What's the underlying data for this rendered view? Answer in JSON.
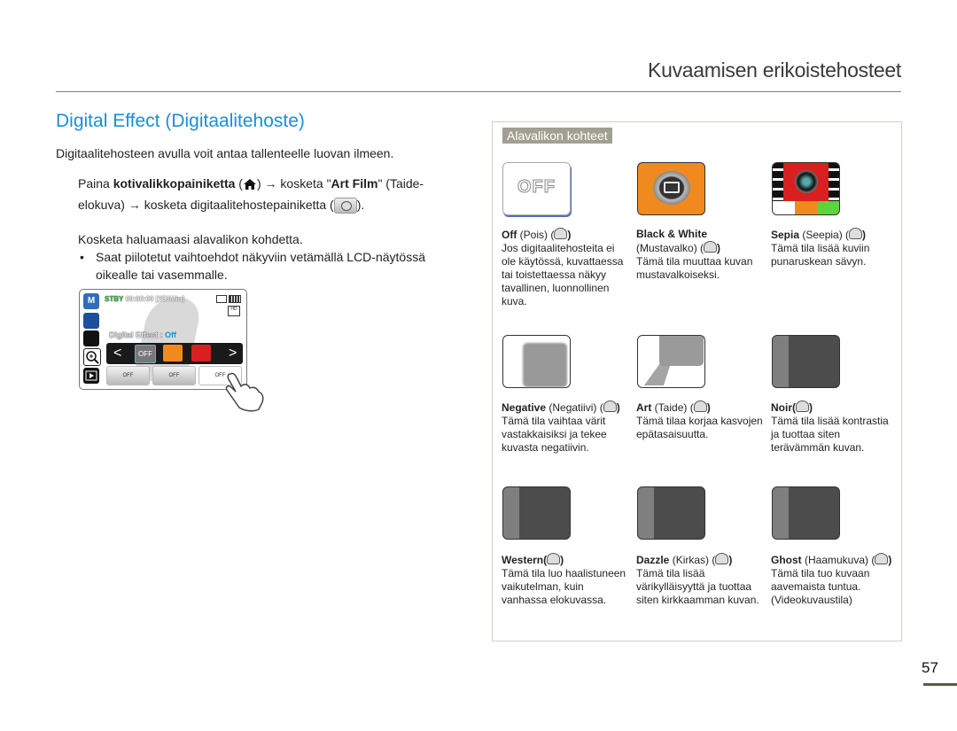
{
  "header": {
    "section_title": "Kuvaamisen erikoistehosteet"
  },
  "heading": "Digital Effect (Digitaalitehoste)",
  "intro": "Digitaalitehosteen avulla voit antaa tallenteelle luovan ilmeen.",
  "step1": {
    "part1": "Paina ",
    "bold1": "kotivalikkopainiketta",
    "part2": " (",
    "home_icon": "home-icon",
    "part3": ") → kosketa \"",
    "bold2": "Art Film",
    "part4": "\" (Taide-elokuva) → kosketa digitaalitehostepainiketta (",
    "effect_icon": "digital-effect-icon",
    "part5": ")."
  },
  "step2": "Kosketa haluamaasi alavalikon kohdetta.",
  "bullet": {
    "dot": "•",
    "text": "Saat piilotetut vaihtoehdot näkyviin vetämällä LCD-näytössä oikealle tai vasemmalle."
  },
  "lcd": {
    "mode": "M",
    "stby": "STBY",
    "time": "00:00:00 [253Min]",
    "effect_label": "Digital Effect : ",
    "effect_value": "Off",
    "prev": "<",
    "next": ">",
    "off_option": "OFF",
    "bottom_buttons": [
      "OFF",
      "OFF",
      "OFF"
    ],
    "hd_badge": "HD"
  },
  "panel": {
    "tag": "Alavalikon kohteet",
    "off_tile_label": "OFF",
    "items": [
      {
        "name": "Off",
        "local": " (Pois) (",
        "close": ")",
        "text": "Jos digitaalitehosteita ei ole käytössä, kuvattaessa tai toistettaessa näkyy tavallinen, luonnollinen kuva."
      },
      {
        "name": "Black & White",
        "local": " (Mustavalko) (",
        "close": ")",
        "text": "Tämä tila muuttaa kuvan mustavalkoiseksi."
      },
      {
        "name": "Sepia",
        "local": " (Seepia) (",
        "close": ")",
        "text": "Tämä tila lisää kuviin punaruskean sävyn."
      },
      {
        "name": "Negative",
        "local": " (Negatiivi) (",
        "close": ")",
        "text": "Tämä tila vaihtaa värit vastakkaisiksi ja tekee kuvasta negatiivin."
      },
      {
        "name": "Art",
        "local": " (Taide) (",
        "close": ")",
        "text": "Tämä tilaa korjaa kasvojen epätasaisuutta."
      },
      {
        "name": "Noir",
        "local": "(",
        "close": ")",
        "text": "Tämä tila lisää kontrastia ja tuottaa siten terävämmän kuvan."
      },
      {
        "name": "Western",
        "local": "(",
        "close": ")",
        "text": "Tämä tila luo haalistuneen vaikutelman, kuin vanhassa elokuvassa."
      },
      {
        "name": "Dazzle",
        "local": " (Kirkas) (",
        "close": ")",
        "text": "Tämä tila lisää värikylläisyyttä ja tuottaa siten kirkkaamman kuvan."
      },
      {
        "name": "Ghost",
        "local": " (Haamukuva) (",
        "close": ")",
        "text": "Tämä tila tuo kuvaan aavemaista tuntua. (Videokuvaustila)"
      }
    ]
  },
  "page_number": "57"
}
